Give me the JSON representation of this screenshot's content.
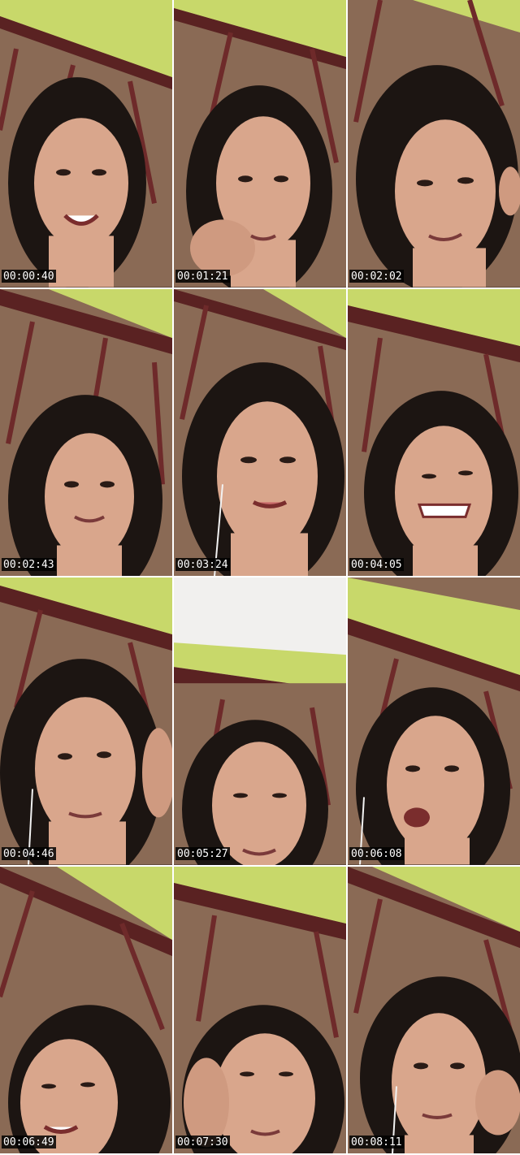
{
  "contact_sheet": {
    "frames": [
      {
        "timestamp": "00:00:40"
      },
      {
        "timestamp": "00:01:21"
      },
      {
        "timestamp": "00:02:02"
      },
      {
        "timestamp": "00:02:43"
      },
      {
        "timestamp": "00:03:24"
      },
      {
        "timestamp": "00:04:05"
      },
      {
        "timestamp": "00:04:46"
      },
      {
        "timestamp": "00:05:27"
      },
      {
        "timestamp": "00:06:08"
      },
      {
        "timestamp": "00:06:49"
      },
      {
        "timestamp": "00:07:30"
      },
      {
        "timestamp": "00:08:11"
      }
    ]
  },
  "colors": {
    "wall": "#8a6a55",
    "bed_frame": "#6e2a2a",
    "mattress": "#c8d86a",
    "hair": "#1c1512",
    "skin": "#d9a68c",
    "timestamp_bg": "#000000",
    "timestamp_text": "#ffffff"
  }
}
